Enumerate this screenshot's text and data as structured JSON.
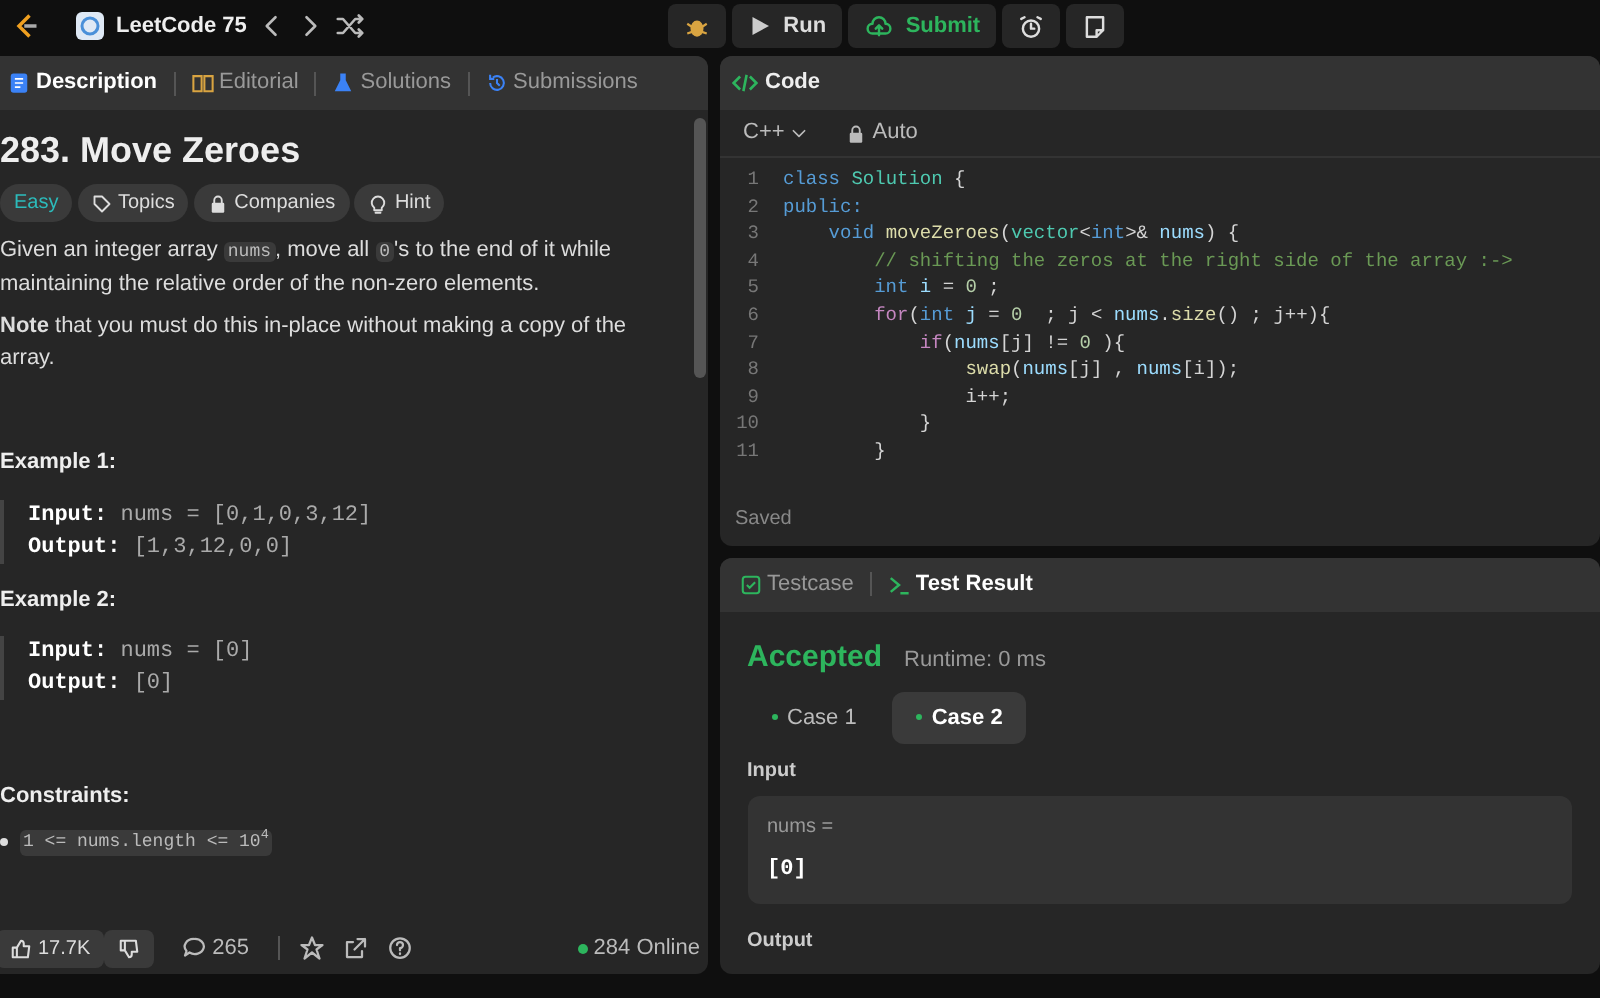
{
  "topbar": {
    "title": "LeetCode 75",
    "run": "Run",
    "submit": "Submit"
  },
  "description": {
    "tabs": [
      {
        "label": "Description",
        "selected": true
      },
      {
        "label": "Editorial",
        "selected": false
      },
      {
        "label": "Solutions",
        "selected": false
      },
      {
        "label": "Submissions",
        "selected": false
      }
    ],
    "title": "283. Move Zeroes",
    "tags": [
      {
        "label": "Easy",
        "kind": "difficulty"
      },
      {
        "label": "Topics",
        "kind": "tag"
      },
      {
        "label": "Companies",
        "kind": "lock"
      },
      {
        "label": "Hint",
        "kind": "bulb"
      }
    ],
    "paragraph": [
      {
        "kind": "text",
        "text": "Given an integer array "
      },
      {
        "kind": "code",
        "text": "nums"
      },
      {
        "kind": "text",
        "text": ", move all "
      },
      {
        "kind": "code",
        "text": "0"
      },
      {
        "kind": "text",
        "text": "'s to the end of it while maintaining the relative order of the non-zero elements."
      }
    ],
    "note": "**Note** that you must do this in-place without making a copy of the array.",
    "examples": [
      {
        "title": "Example 1:",
        "lines": [
          {
            "label": "Input:",
            "value": "nums = [0,1,0,3,12]"
          },
          {
            "label": "Output:",
            "value": "[1,3,12,0,0]"
          }
        ]
      },
      {
        "title": "Example 2:",
        "lines": [
          {
            "label": "Input:",
            "value": "nums = [0]"
          },
          {
            "label": "Output:",
            "value": "[0]"
          }
        ]
      }
    ],
    "constraints_title": "Constraints:",
    "constraints": [
      "1 <= nums.length <= 10$^{4}$"
    ],
    "footer": {
      "likes": "17.7K",
      "comments": "265",
      "online": "284 Online"
    }
  },
  "code": {
    "title": "Code",
    "language": "C++",
    "mode": "Auto",
    "status": "Saved",
    "lines": [
      {
        "num": "1",
        "tokens": [
          {
            "kind": "kw",
            "text": "class "
          },
          {
            "kind": "type",
            "text": "Solution"
          },
          {
            "kind": "p",
            "text": " {"
          }
        ]
      },
      {
        "num": "2",
        "tokens": [
          {
            "kind": "kw",
            "text": "public:"
          }
        ]
      },
      {
        "num": "3",
        "tokens": [
          {
            "kind": "kw",
            "text": "    void "
          },
          {
            "kind": "fn",
            "text": "moveZeroes"
          },
          {
            "kind": "p",
            "text": "("
          },
          {
            "kind": "type",
            "text": "vector"
          },
          {
            "kind": "p",
            "text": "<"
          },
          {
            "kind": "kw",
            "text": "int"
          },
          {
            "kind": "p",
            "text": ">& "
          },
          {
            "kind": "var",
            "text": "nums"
          },
          {
            "kind": "p",
            "text": ") {"
          }
        ]
      },
      {
        "num": "4",
        "tokens": [
          {
            "kind": "cm",
            "text": "        // shifting the zeros at the right side of the array :->"
          }
        ]
      },
      {
        "num": "5",
        "tokens": [
          {
            "kind": "kw",
            "text": "        int "
          },
          {
            "kind": "var",
            "text": "i"
          },
          {
            "kind": "p",
            "text": " = "
          },
          {
            "kind": "num",
            "text": "0"
          },
          {
            "kind": "p",
            "text": " ;"
          }
        ]
      },
      {
        "num": "6",
        "tokens": [
          {
            "kind": "ctl",
            "text": "        for"
          },
          {
            "kind": "p",
            "text": "("
          },
          {
            "kind": "kw",
            "text": "int "
          },
          {
            "kind": "var",
            "text": "j"
          },
          {
            "kind": "p",
            "text": " = "
          },
          {
            "kind": "num",
            "text": "0"
          },
          {
            "kind": "p",
            "text": "  ; j < "
          },
          {
            "kind": "var",
            "text": "nums"
          },
          {
            "kind": "p",
            "text": "."
          },
          {
            "kind": "fn",
            "text": "size"
          },
          {
            "kind": "p",
            "text": "() ; j++){"
          }
        ]
      },
      {
        "num": "7",
        "tokens": [
          {
            "kind": "ctl",
            "text": "            if"
          },
          {
            "kind": "p",
            "text": "("
          },
          {
            "kind": "var",
            "text": "nums"
          },
          {
            "kind": "p",
            "text": "[j] != "
          },
          {
            "kind": "num",
            "text": "0"
          },
          {
            "kind": "p",
            "text": " ){"
          }
        ]
      },
      {
        "num": "8",
        "tokens": [
          {
            "kind": "fn",
            "text": "                swap"
          },
          {
            "kind": "p",
            "text": "("
          },
          {
            "kind": "var",
            "text": "nums"
          },
          {
            "kind": "p",
            "text": "[j] , "
          },
          {
            "kind": "var",
            "text": "nums"
          },
          {
            "kind": "p",
            "text": "[i]);"
          }
        ]
      },
      {
        "num": "9",
        "tokens": [
          {
            "kind": "p",
            "text": "                i++;"
          }
        ]
      },
      {
        "num": "10",
        "tokens": [
          {
            "kind": "p",
            "text": "            }"
          }
        ]
      },
      {
        "num": "11",
        "tokens": [
          {
            "kind": "p",
            "text": "        }"
          }
        ]
      }
    ]
  },
  "result": {
    "tabs": [
      {
        "label": "Testcase",
        "selected": false
      },
      {
        "label": "Test Result",
        "selected": true
      }
    ],
    "verdict": "Accepted",
    "runtime": "Runtime: 0 ms",
    "cases": [
      {
        "label": "Case 1",
        "selected": false
      },
      {
        "label": "Case 2",
        "selected": true
      }
    ],
    "input_title": "Input",
    "input_var": "nums =",
    "input_value": "[0]",
    "output_title": "Output"
  }
}
